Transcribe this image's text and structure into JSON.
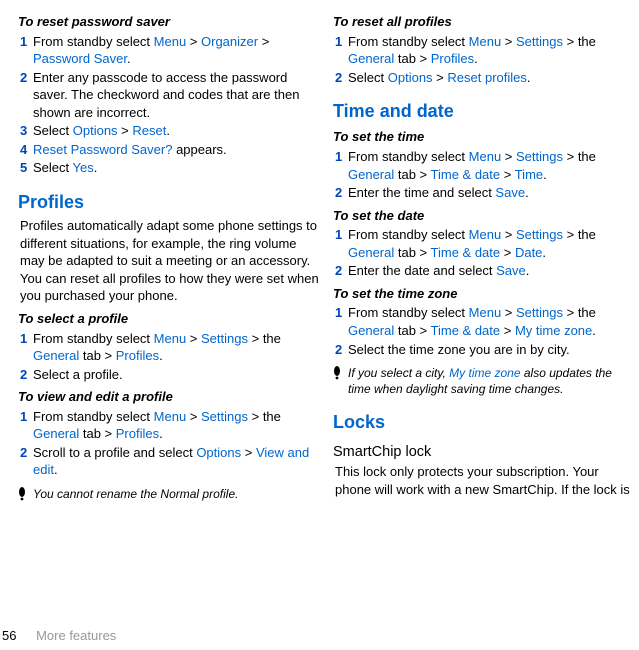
{
  "col1": {
    "h1": "To reset password saver",
    "s1_1a": "From standby select ",
    "s1_1b": "Menu",
    "s1_1c": " > ",
    "s1_1d": "Organizer",
    "s1_1e": " > ",
    "s1_1f": "Password Saver",
    "s1_1g": ".",
    "s1_2": "Enter any passcode to access the password saver. The checkword and codes that are then shown are incorrect.",
    "s1_3a": "Select ",
    "s1_3b": "Options",
    "s1_3c": " > ",
    "s1_3d": "Reset",
    "s1_3e": ".",
    "s1_4a": "Reset Password Saver?",
    "s1_4b": " appears.",
    "s1_5a": "Select ",
    "s1_5b": "Yes",
    "s1_5c": ".",
    "profiles_head": "Profiles",
    "profiles_para": "Profiles automatically adapt some phone settings to different situations, for example, the ring volume may be adapted to suit a meeting or an accessory. You can reset all profiles to how they were set when you purchased your phone.",
    "h2": "To select a profile",
    "s2_1a": "From standby select ",
    "s2_1b": "Menu",
    "s2_1c": " > ",
    "s2_1d": "Settings",
    "s2_1e": " > the ",
    "s2_1f": "General",
    "s2_1g": " tab > ",
    "s2_1h": "Profiles",
    "s2_1i": ".",
    "s2_2": "Select a profile.",
    "h3": "To view and edit a profile",
    "s3_1a": "From standby select ",
    "s3_1b": "Menu",
    "s3_1c": " > ",
    "s3_1d": "Settings",
    "s3_1e": " > the ",
    "s3_1f": "General",
    "s3_1g": " tab > ",
    "s3_1h": "Profiles",
    "s3_1i": ".",
    "s3_2a": "Scroll to a profile and select ",
    "s3_2b": "Options",
    "s3_2c": " > ",
    "s3_2d": "View and edit",
    "s3_2e": ".",
    "note1": "You cannot rename the Normal profile."
  },
  "col2": {
    "h1": "To reset all profiles",
    "r1_1a": "From standby select ",
    "r1_1b": "Menu",
    "r1_1c": " > ",
    "r1_1d": "Settings",
    "r1_1e": " > the ",
    "r1_1f": "General",
    "r1_1g": " tab > ",
    "r1_1h": "Profiles",
    "r1_1i": ".",
    "r1_2a": "Select ",
    "r1_2b": "Options",
    "r1_2c": " > ",
    "r1_2d": "Reset profiles",
    "r1_2e": ".",
    "timedate_head": "Time and date",
    "h2": "To set the time",
    "t1_1a": "From standby select ",
    "t1_1b": "Menu",
    "t1_1c": " > ",
    "t1_1d": "Settings",
    "t1_1e": " > the ",
    "t1_1f": "General",
    "t1_1g": " tab > ",
    "t1_1h": "Time & date",
    "t1_1i": " > ",
    "t1_1j": "Time",
    "t1_1k": ".",
    "t1_2a": "Enter the time and select ",
    "t1_2b": "Save",
    "t1_2c": ".",
    "h3": "To set the date",
    "d1_1a": "From standby select ",
    "d1_1b": "Menu",
    "d1_1c": " > ",
    "d1_1d": "Settings",
    "d1_1e": " > the ",
    "d1_1f": "General",
    "d1_1g": " tab > ",
    "d1_1h": "Time & date",
    "d1_1i": " > ",
    "d1_1j": "Date",
    "d1_1k": ".",
    "d1_2a": "Enter the date and select ",
    "d1_2b": "Save",
    "d1_2c": ".",
    "h4": "To set the time zone",
    "z1_1a": "From standby select ",
    "z1_1b": "Menu",
    "z1_1c": " > ",
    "z1_1d": "Settings",
    "z1_1e": " > the ",
    "z1_1f": "General",
    "z1_1g": " tab > ",
    "z1_1h": "Time & date",
    "z1_1i": " > ",
    "z1_1j": "My time zone",
    "z1_1k": ".",
    "z1_2": "Select the time zone you are in by city.",
    "note2a": "If you select a city, ",
    "note2b": "My time zone",
    "note2c": " also updates the time when daylight saving time changes.",
    "locks_head": "Locks",
    "locks_sub": "SmartChip lock",
    "locks_para": "This lock only protects your subscription. Your phone will work with a new SmartChip. If the lock is"
  },
  "nums": {
    "n1": "1",
    "n2": "2",
    "n3": "3",
    "n4": "4",
    "n5": "5"
  },
  "footer": {
    "page": "56",
    "section": "More features"
  }
}
